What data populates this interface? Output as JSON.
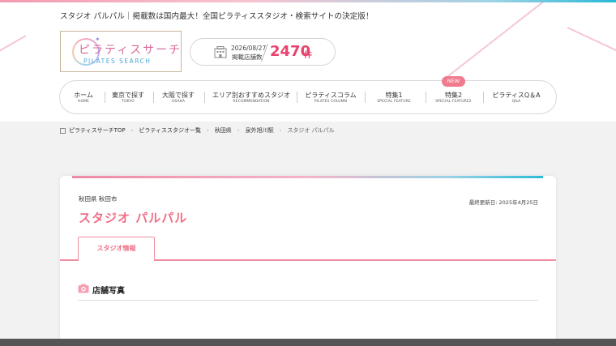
{
  "tagline": "スタジオ パルパル｜掲載数は国内最大！全国ピラティススタジオ・検索サイトの決定版！",
  "logo": {
    "jp": "ピラティスサーチ",
    "en": "PILATES SEARCH",
    "spark_icon": "sparkle-icon"
  },
  "stats": {
    "date": "2026/08/27",
    "label": "掲載店舗数",
    "count": "2470",
    "unit": "件",
    "icon": "building-icon"
  },
  "nav": [
    {
      "jp": "ホーム",
      "en": "HOME"
    },
    {
      "jp": "東京で探す",
      "en": "TOKYO"
    },
    {
      "jp": "大阪で探す",
      "en": "OSAKA"
    },
    {
      "jp": "エリア別おすすめスタジオ",
      "en": "RECOMMENDATION"
    },
    {
      "jp": "ピラティスコラム",
      "en": "PILATES COLUMN"
    },
    {
      "jp": "特集1",
      "en": "SPECIAL FEATURE"
    },
    {
      "jp": "特集2",
      "en": "SPECIAL FEATURE2"
    },
    {
      "jp": "ピラティスQ＆A",
      "en": "Q&A"
    }
  ],
  "nav_badge": "NEW",
  "breadcrumb": [
    "ピラティスサーチTOP",
    "ピラティススタジオ一覧",
    "秋田県",
    "泉外旭川駅",
    "スタジオ パルパル"
  ],
  "studio": {
    "pref_city": "秋田県 秋田市",
    "updated": "最終更新日: 2025年4月25日",
    "name": "スタジオ パルパル",
    "tab": "スタジオ情報",
    "section_title": "店舗写真",
    "section_icon": "camera-icon"
  },
  "colors": {
    "accent": "#ef6f86",
    "count": "#e9436f",
    "cyan": "#2bbbd8"
  }
}
